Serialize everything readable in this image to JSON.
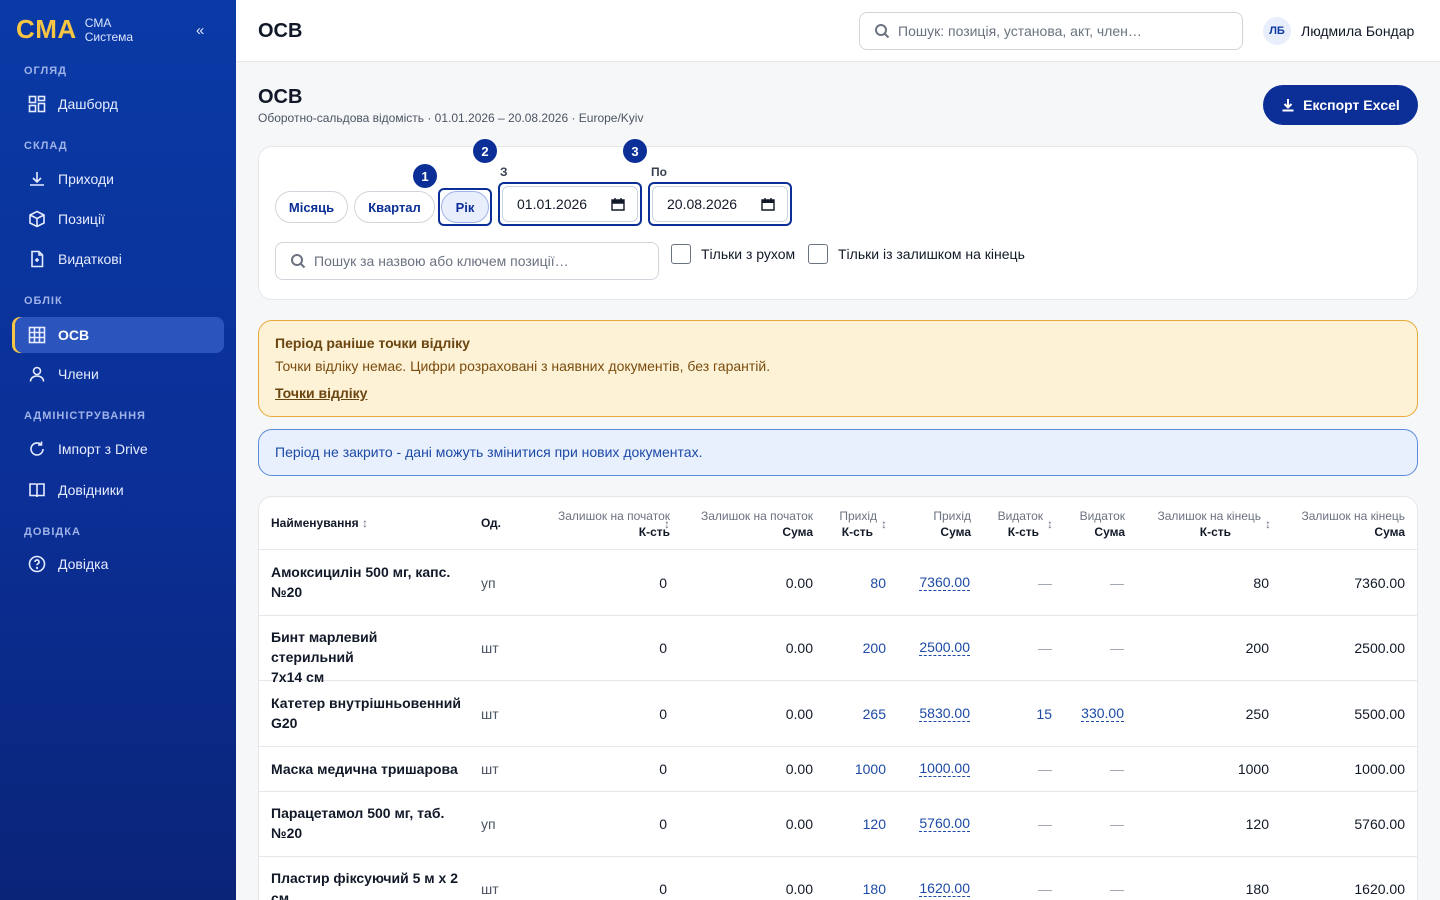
{
  "brand": {
    "logo": "CMA",
    "sub1": "CMA",
    "sub2": "Система",
    "collapse": "«"
  },
  "nav": {
    "sections": [
      "ОГЛЯД",
      "СКЛАД",
      "ОБЛІК",
      "АДМІНІСТРУВАННЯ",
      "ДОВІДКА"
    ],
    "items": [
      "Дашборд",
      "Приходи",
      "Позиції",
      "Видаткові",
      "ОСВ",
      "Члени",
      "Імпорт з Drive",
      "Довідники",
      "Довідка"
    ]
  },
  "topbar": {
    "title": "ОСВ",
    "search_placeholder": "Пошук: позиція, установа, акт, член…",
    "user_initials": "ЛБ",
    "user_name": "Людмила Бондар"
  },
  "page": {
    "title": "ОСВ",
    "subtitle": "Оборотно-сальдова відомість · 01.01.2026 – 20.08.2026 · Europe/Kyiv",
    "export": "Експорт Excel"
  },
  "filters": {
    "periods": [
      "Місяць",
      "Квартал",
      "Рік"
    ],
    "selected_period": "Рік",
    "badges": [
      "1",
      "2",
      "3"
    ],
    "from_label": "З",
    "from_value": "01.01.2026",
    "to_label": "По",
    "to_value": "20.08.2026",
    "search_placeholder": "Пошук за назвою або ключем позиції…",
    "chk_movement": "Тільки з рухом",
    "chk_balance": "Тільки із залишком на кінець"
  },
  "warning": {
    "title": "Період раніше точки відліку",
    "text": "Точки відліку немає. Цифри розраховані з наявних документів, без гарантій.",
    "link": "Точки відліку"
  },
  "info": {
    "text": "Період не закрито - дані можуть змінитися при нових документах."
  },
  "table": {
    "headers": {
      "name": "Найменування",
      "unit": "Од.",
      "open_qty_top": "Залишок на початок",
      "open_qty_bot": "К-сть",
      "open_sum_top": "Залишок на початок",
      "open_sum_bot": "Сума",
      "in_qty_top": "Прихід",
      "in_qty_bot": "К-сть",
      "in_sum_top": "Прихід",
      "in_sum_bot": "Сума",
      "out_qty_top": "Видаток",
      "out_qty_bot": "К-сть",
      "out_sum_top": "Видаток",
      "out_sum_bot": "Сума",
      "close_qty_top": "Залишок на кінець",
      "close_qty_bot": "К-сть",
      "close_sum_top": "Залишок на кінець",
      "close_sum_bot": "Сума",
      "sort": "↕"
    },
    "rows": [
      {
        "name1": "Амоксицилін 500 мг, капс.",
        "name2": "№20",
        "unit": "уп",
        "open_qty": "0",
        "open_sum": "0.00",
        "in_qty": "80",
        "in_sum": "7360.00",
        "out_qty": "—",
        "out_sum": "—",
        "close_qty": "80",
        "close_sum": "7360.00"
      },
      {
        "name1": "Бинт марлевий стерильний",
        "name2": "7х14 см",
        "unit": "шт",
        "open_qty": "0",
        "open_sum": "0.00",
        "in_qty": "200",
        "in_sum": "2500.00",
        "out_qty": "—",
        "out_sum": "—",
        "close_qty": "200",
        "close_sum": "2500.00"
      },
      {
        "name1": "Катетер внутрішньовенний",
        "name2": "G20",
        "unit": "шт",
        "open_qty": "0",
        "open_sum": "0.00",
        "in_qty": "265",
        "in_sum": "5830.00",
        "out_qty": "15",
        "out_sum": "330.00",
        "close_qty": "250",
        "close_sum": "5500.00"
      },
      {
        "name1": "Маска медична тришарова",
        "name2": "",
        "unit": "шт",
        "open_qty": "0",
        "open_sum": "0.00",
        "in_qty": "1000",
        "in_sum": "1000.00",
        "out_qty": "—",
        "out_sum": "—",
        "close_qty": "1000",
        "close_sum": "1000.00"
      },
      {
        "name1": "Парацетамол 500 мг, таб.",
        "name2": "№20",
        "unit": "уп",
        "open_qty": "0",
        "open_sum": "0.00",
        "in_qty": "120",
        "in_sum": "5760.00",
        "out_qty": "—",
        "out_sum": "—",
        "close_qty": "120",
        "close_sum": "5760.00"
      },
      {
        "name1": "Пластир фіксуючий 5 м х 2",
        "name2": "см",
        "unit": "шт",
        "open_qty": "0",
        "open_sum": "0.00",
        "in_qty": "180",
        "in_sum": "1620.00",
        "out_qty": "—",
        "out_sum": "—",
        "close_qty": "180",
        "close_sum": "1620.00"
      }
    ]
  }
}
